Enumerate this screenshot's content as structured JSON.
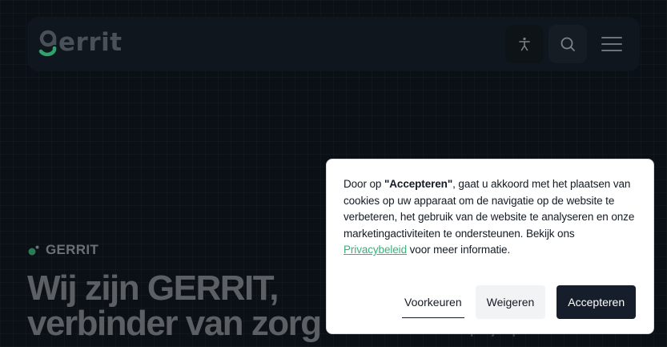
{
  "header": {
    "logo_text": "errit",
    "accessibility_icon": "accessibility-person-icon",
    "search_icon": "search-icon",
    "menu_icon": "hamburger-menu-icon"
  },
  "hero": {
    "tag": "GERRIT",
    "title_line1": "Wij zijn GERRIT,",
    "title_line2": "verbinder van zorg",
    "partial_text": "...menten op bij kop..."
  },
  "cookie_banner": {
    "text_before": "Door op ",
    "text_bold": "\"Accepteren\"",
    "text_after": ", gaat u akkoord met het plaatsen van cookies op uw apparaat om de navigatie op de website te verbeteren, het gebruik van de website te analyseren en onze marketingactiviteiten te ondersteunen. Bekijk ons ",
    "link_text": "Privacybeleid",
    "text_end": " voor meer informatie.",
    "preferences_label": "Voorkeuren",
    "reject_label": "Weigeren",
    "accept_label": "Accepteren"
  },
  "colors": {
    "background": "#0b1016",
    "brand_green": "#37b17a",
    "accept_button": "#161e2b"
  }
}
